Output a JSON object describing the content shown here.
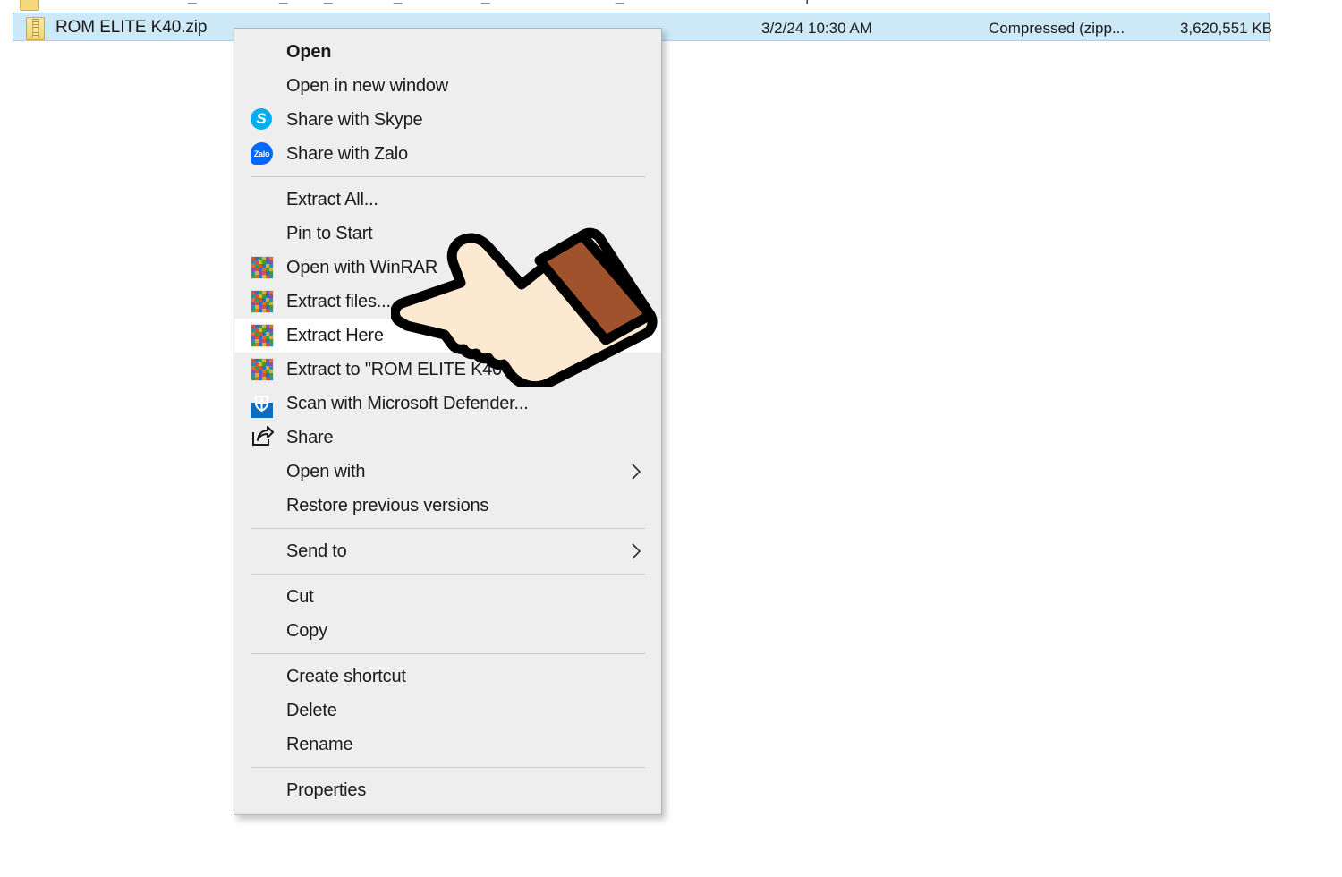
{
  "explorer": {
    "partial_row_above": {
      "visible_fragments": "- - - - - - |"
    },
    "selected_file": {
      "name": "ROM ELITE K40.zip",
      "date_modified": "3/2/24 10:30 AM",
      "type": "Compressed (zipp...",
      "size": "3,620,551 KB",
      "icon": "zip-folder-icon",
      "selected": true,
      "selection_color": "#cde8f7"
    }
  },
  "context_menu": {
    "background": "#eeeeee",
    "border_color": "#b4b4b4",
    "highlighted_item": "Extract Here",
    "groups": [
      {
        "items": [
          {
            "label": "Open",
            "icon": null,
            "bold": true,
            "submenu": false
          },
          {
            "label": "Open in new window",
            "icon": null,
            "bold": false,
            "submenu": false
          },
          {
            "label": "Share with Skype",
            "icon": "skype-icon",
            "bold": false,
            "submenu": false
          },
          {
            "label": "Share with Zalo",
            "icon": "zalo-icon",
            "bold": false,
            "submenu": false
          }
        ]
      },
      {
        "items": [
          {
            "label": "Extract All...",
            "icon": null,
            "bold": false,
            "submenu": false
          },
          {
            "label": "Pin to Start",
            "icon": null,
            "bold": false,
            "submenu": false
          },
          {
            "label": "Open with WinRAR",
            "icon": "winrar-icon",
            "bold": false,
            "submenu": false
          },
          {
            "label": "Extract files...",
            "icon": "winrar-icon",
            "bold": false,
            "submenu": false
          },
          {
            "label": "Extract Here",
            "icon": "winrar-icon",
            "bold": false,
            "submenu": false,
            "highlighted": true
          },
          {
            "label": "Extract to \"ROM ELITE K40\\\"",
            "icon": "winrar-icon",
            "bold": false,
            "submenu": false
          },
          {
            "label": "Scan with Microsoft Defender...",
            "icon": "defender-shield-icon",
            "bold": false,
            "submenu": false
          },
          {
            "label": "Share",
            "icon": "share-icon",
            "bold": false,
            "submenu": false
          },
          {
            "label": "Open with",
            "icon": null,
            "bold": false,
            "submenu": true
          },
          {
            "label": "Restore previous versions",
            "icon": null,
            "bold": false,
            "submenu": false
          }
        ]
      },
      {
        "items": [
          {
            "label": "Send to",
            "icon": null,
            "bold": false,
            "submenu": true
          }
        ]
      },
      {
        "items": [
          {
            "label": "Cut",
            "icon": null,
            "bold": false,
            "submenu": false
          },
          {
            "label": "Copy",
            "icon": null,
            "bold": false,
            "submenu": false
          }
        ]
      },
      {
        "items": [
          {
            "label": "Create shortcut",
            "icon": null,
            "bold": false,
            "submenu": false
          },
          {
            "label": "Delete",
            "icon": null,
            "bold": false,
            "submenu": false
          },
          {
            "label": "Rename",
            "icon": null,
            "bold": false,
            "submenu": false
          }
        ]
      },
      {
        "items": [
          {
            "label": "Properties",
            "icon": null,
            "bold": false,
            "submenu": false
          }
        ]
      }
    ]
  },
  "annotation": {
    "pointer": {
      "type": "pointing-hand-cursor",
      "points_at": "Extract Here",
      "hand_fill": "#fce9d2",
      "sleeve_fill": "#a0522d",
      "outline": "#000000"
    }
  }
}
